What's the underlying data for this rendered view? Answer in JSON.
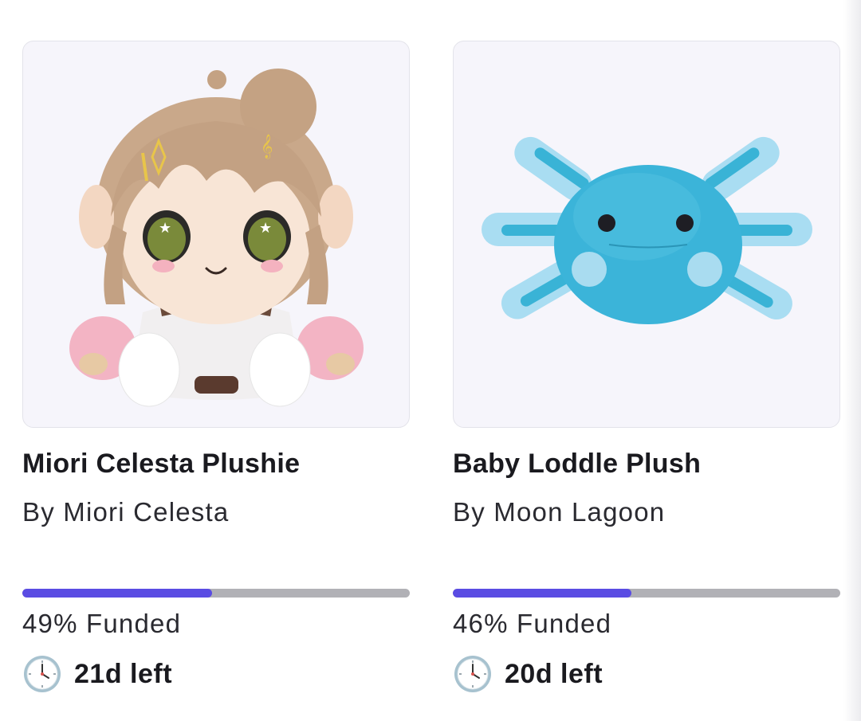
{
  "products": [
    {
      "title": "Miori Celesta Plushie",
      "creator": "By Miori Celesta",
      "funded_percent": 49,
      "funded_label": "49% Funded",
      "time_left": "21d left",
      "image_icon": "plush-girl-image"
    },
    {
      "title": "Baby Loddle Plush",
      "creator": "By Moon Lagoon",
      "funded_percent": 46,
      "funded_label": "46% Funded",
      "time_left": "20d left",
      "image_icon": "plush-axolotl-image"
    }
  ],
  "colors": {
    "progress_fill": "#5a4ce3",
    "progress_track": "#b1b1b6",
    "image_bg": "#f6f5fb"
  },
  "icons": {
    "time": "clock-icon"
  }
}
